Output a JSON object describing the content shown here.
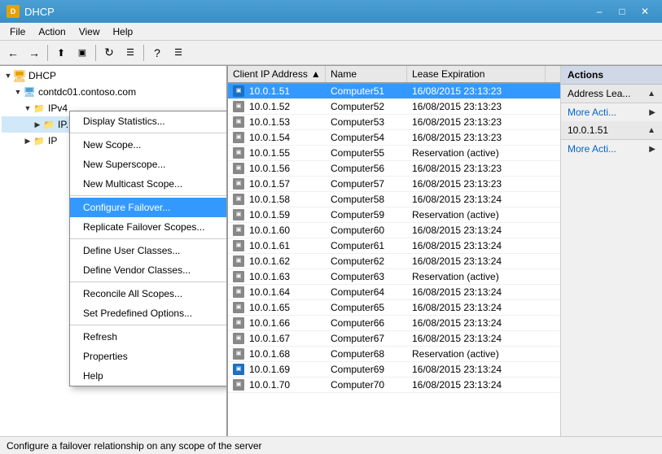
{
  "window": {
    "title": "DHCP",
    "min": "–",
    "max": "□",
    "close": "✕"
  },
  "menubar": {
    "items": [
      "File",
      "Action",
      "View",
      "Help"
    ]
  },
  "toolbar": {
    "buttons": [
      "←",
      "→",
      "↑",
      "⬛",
      "⟳",
      "☰",
      "?",
      "☰"
    ]
  },
  "tree": {
    "header": "",
    "nodes": [
      {
        "label": "DHCP",
        "indent": 0,
        "icon": "dhcp",
        "expand": "▼"
      },
      {
        "label": "contdc01.contoso.com",
        "indent": 1,
        "icon": "server",
        "expand": "▼"
      },
      {
        "label": "IPv4",
        "indent": 2,
        "icon": "folder",
        "expand": "▼"
      },
      {
        "label": "IP...",
        "indent": 3,
        "icon": "folder",
        "expand": "▶"
      },
      {
        "label": "IP",
        "indent": 2,
        "icon": "folder",
        "expand": "▶"
      }
    ]
  },
  "context_menu": {
    "items": [
      {
        "label": "Display Statistics...",
        "type": "normal"
      },
      {
        "label": "",
        "type": "sep"
      },
      {
        "label": "New Scope...",
        "type": "normal"
      },
      {
        "label": "New Superscope...",
        "type": "normal"
      },
      {
        "label": "New Multicast Scope...",
        "type": "normal"
      },
      {
        "label": "",
        "type": "sep"
      },
      {
        "label": "Configure Failover...",
        "type": "selected"
      },
      {
        "label": "Replicate Failover Scopes...",
        "type": "normal"
      },
      {
        "label": "",
        "type": "sep"
      },
      {
        "label": "Define User Classes...",
        "type": "normal"
      },
      {
        "label": "Define Vendor Classes...",
        "type": "normal"
      },
      {
        "label": "",
        "type": "sep"
      },
      {
        "label": "Reconcile All Scopes...",
        "type": "normal"
      },
      {
        "label": "Set Predefined Options...",
        "type": "normal"
      },
      {
        "label": "",
        "type": "sep"
      },
      {
        "label": "Refresh",
        "type": "normal"
      },
      {
        "label": "Properties",
        "type": "normal"
      },
      {
        "label": "Help",
        "type": "normal"
      }
    ]
  },
  "list": {
    "columns": [
      "Client IP Address",
      "Name",
      "Lease Expiration"
    ],
    "rows": [
      {
        "ip": "10.0.1.51",
        "name": "Computer51",
        "lease": "16/08/2015 23:13:23",
        "selected": true,
        "icon": "blue"
      },
      {
        "ip": "10.0.1.52",
        "name": "Computer52",
        "lease": "16/08/2015 23:13:23",
        "selected": false,
        "icon": "gray"
      },
      {
        "ip": "10.0.1.53",
        "name": "Computer53",
        "lease": "16/08/2015 23:13:23",
        "selected": false,
        "icon": "gray"
      },
      {
        "ip": "10.0.1.54",
        "name": "Computer54",
        "lease": "16/08/2015 23:13:23",
        "selected": false,
        "icon": "gray"
      },
      {
        "ip": "10.0.1.55",
        "name": "Computer55",
        "lease": "Reservation (active)",
        "selected": false,
        "icon": "gray"
      },
      {
        "ip": "10.0.1.56",
        "name": "Computer56",
        "lease": "16/08/2015 23:13:23",
        "selected": false,
        "icon": "gray"
      },
      {
        "ip": "10.0.1.57",
        "name": "Computer57",
        "lease": "16/08/2015 23:13:23",
        "selected": false,
        "icon": "gray"
      },
      {
        "ip": "10.0.1.58",
        "name": "Computer58",
        "lease": "16/08/2015 23:13:24",
        "selected": false,
        "icon": "gray"
      },
      {
        "ip": "10.0.1.59",
        "name": "Computer59",
        "lease": "Reservation (active)",
        "selected": false,
        "icon": "gray"
      },
      {
        "ip": "10.0.1.60",
        "name": "Computer60",
        "lease": "16/08/2015 23:13:24",
        "selected": false,
        "icon": "gray"
      },
      {
        "ip": "10.0.1.61",
        "name": "Computer61",
        "lease": "16/08/2015 23:13:24",
        "selected": false,
        "icon": "gray"
      },
      {
        "ip": "10.0.1.62",
        "name": "Computer62",
        "lease": "16/08/2015 23:13:24",
        "selected": false,
        "icon": "gray"
      },
      {
        "ip": "10.0.1.63",
        "name": "Computer63",
        "lease": "Reservation (active)",
        "selected": false,
        "icon": "gray"
      },
      {
        "ip": "10.0.1.64",
        "name": "Computer64",
        "lease": "16/08/2015 23:13:24",
        "selected": false,
        "icon": "gray"
      },
      {
        "ip": "10.0.1.65",
        "name": "Computer65",
        "lease": "16/08/2015 23:13:24",
        "selected": false,
        "icon": "gray"
      },
      {
        "ip": "10.0.1.66",
        "name": "Computer66",
        "lease": "16/08/2015 23:13:24",
        "selected": false,
        "icon": "gray"
      },
      {
        "ip": "10.0.1.67",
        "name": "Computer67",
        "lease": "16/08/2015 23:13:24",
        "selected": false,
        "icon": "gray"
      },
      {
        "ip": "10.0.1.68",
        "name": "Computer68",
        "lease": "Reservation (active)",
        "selected": false,
        "icon": "gray"
      },
      {
        "ip": "10.0.1.69",
        "name": "Computer69",
        "lease": "16/08/2015 23:13:24",
        "selected": false,
        "icon": "blue"
      },
      {
        "ip": "10.0.1.70",
        "name": "Computer70",
        "lease": "16/08/2015 23:13:24",
        "selected": false,
        "icon": "gray"
      }
    ]
  },
  "actions": {
    "header": "Actions",
    "sections": [
      {
        "title": "Address Lea...",
        "arrow": "▲",
        "items": [
          {
            "label": "More Acti...",
            "arrow": "▶"
          }
        ]
      },
      {
        "title": "10.0.1.51",
        "arrow": "▲",
        "items": [
          {
            "label": "More Acti...",
            "arrow": "▶"
          }
        ]
      }
    ]
  },
  "status_bar": {
    "text": "Configure a failover relationship on any scope of the server"
  }
}
